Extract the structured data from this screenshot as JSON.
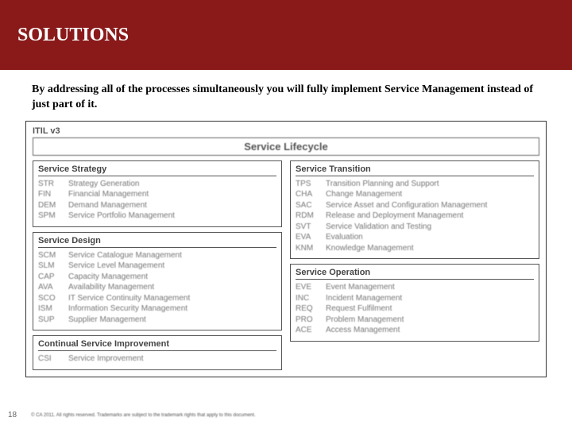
{
  "header": {
    "title": "SOLUTIONS"
  },
  "subtitle": "By addressing all of the processes simultaneously you will fully implement Service Management instead of just part of it.",
  "diagram": {
    "framework_label": "ITIL v3",
    "lifecycle_label": "Service Lifecycle",
    "left": [
      {
        "title": "Service Strategy",
        "items": [
          {
            "abbr": "STR",
            "desc": "Strategy Generation"
          },
          {
            "abbr": "FIN",
            "desc": "Financial Management"
          },
          {
            "abbr": "DEM",
            "desc": "Demand Management"
          },
          {
            "abbr": "SPM",
            "desc": "Service Portfolio Management"
          }
        ]
      },
      {
        "title": "Service Design",
        "items": [
          {
            "abbr": "SCM",
            "desc": "Service Catalogue Management"
          },
          {
            "abbr": "SLM",
            "desc": "Service Level Management"
          },
          {
            "abbr": "CAP",
            "desc": "Capacity Management"
          },
          {
            "abbr": "AVA",
            "desc": "Availability Management"
          },
          {
            "abbr": "SCO",
            "desc": "IT Service Continuity Management"
          },
          {
            "abbr": "ISM",
            "desc": "Information Security Management"
          },
          {
            "abbr": "SUP",
            "desc": "Supplier Management"
          }
        ]
      },
      {
        "title": "Continual Service Improvement",
        "items": [
          {
            "abbr": "CSI",
            "desc": "Service Improvement"
          }
        ]
      }
    ],
    "right": [
      {
        "title": "Service Transition",
        "items": [
          {
            "abbr": "TPS",
            "desc": "Transition Planning and Support"
          },
          {
            "abbr": "CHA",
            "desc": "Change Management"
          },
          {
            "abbr": "SAC",
            "desc": "Service Asset and Configuration Management"
          },
          {
            "abbr": "RDM",
            "desc": "Release and Deployment Management"
          },
          {
            "abbr": "SVT",
            "desc": "Service Validation and Testing"
          },
          {
            "abbr": "EVA",
            "desc": "Evaluation"
          },
          {
            "abbr": "KNM",
            "desc": "Knowledge Management"
          }
        ]
      },
      {
        "title": "Service Operation",
        "items": [
          {
            "abbr": "EVE",
            "desc": "Event Management"
          },
          {
            "abbr": "INC",
            "desc": "Incident Management"
          },
          {
            "abbr": "REQ",
            "desc": "Request Fulfilment"
          },
          {
            "abbr": "PRO",
            "desc": "Problem Management"
          },
          {
            "abbr": "ACE",
            "desc": "Access Management"
          }
        ]
      }
    ]
  },
  "footer": {
    "page": "18",
    "copyright": "© CA 2011. All rights reserved. Trademarks are subject to the trademark rights that apply to this document."
  }
}
